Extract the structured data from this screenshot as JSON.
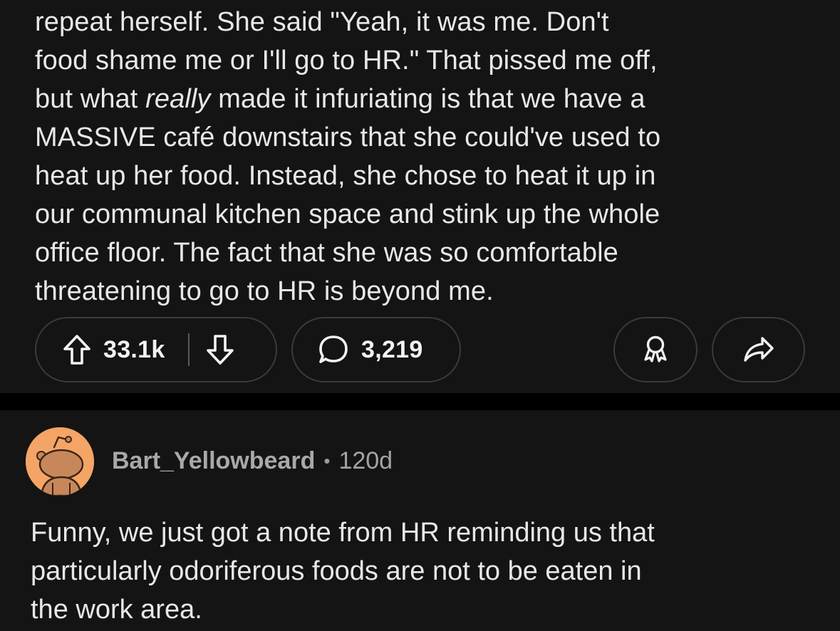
{
  "post": {
    "body_part1": "repeat herself.  She said \"Yeah, it was me. Don't\nfood shame me or I'll go to HR.\" That pissed me off,\nbut what ",
    "body_emphasis": "really",
    "body_part2": " made it infuriating is that we have a\nMASSIVE café downstairs that she could've used to\nheat up her food. Instead, she chose to heat it up in\nour communal kitchen space and stink up the whole\noffice floor. The fact that she was so comfortable\nthreatening to go to HR is beyond me.",
    "actions": {
      "vote_count": "33.1k",
      "comment_count": "3,219",
      "upvote_icon": "arrow-up-icon",
      "downvote_icon": "arrow-down-icon",
      "comment_icon": "speech-bubble-icon",
      "award_icon": "award-icon",
      "share_icon": "share-arrow-icon"
    }
  },
  "comment": {
    "author": "Bart_Yellowbeard",
    "separator": "•",
    "age": "120d",
    "avatar_color": "#f4a566",
    "body": "Funny, we just got a note from HR reminding us that\nparticularly odoriferous foods are not to be eaten in\nthe work area."
  }
}
